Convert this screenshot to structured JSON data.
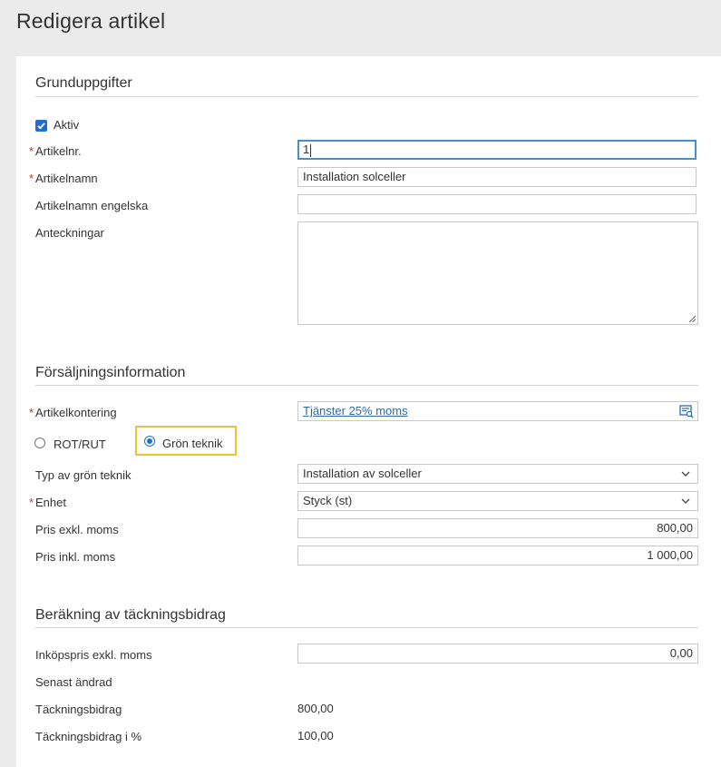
{
  "page": {
    "title": "Redigera artikel"
  },
  "sections": {
    "basic": {
      "title": "Grunduppgifter"
    },
    "sales": {
      "title": "Försäljningsinformation"
    },
    "margin": {
      "title": "Beräkning av täckningsbidrag"
    }
  },
  "basic": {
    "active_label": "Aktiv",
    "active_checked": true,
    "article_no_label": "Artikelnr.",
    "article_no_value": "1",
    "article_name_label": "Artikelnamn",
    "article_name_value": "Installation solceller",
    "article_name_en_label": "Artikelnamn engelska",
    "article_name_en_value": "",
    "notes_label": "Anteckningar",
    "notes_value": ""
  },
  "sales": {
    "account_label": "Artikelkontering",
    "account_value": "Tjänster 25% moms",
    "rot_rut_label": "ROT/RUT",
    "green_tech_label": "Grön teknik",
    "green_tech_selected": true,
    "green_type_label": "Typ av grön teknik",
    "green_type_value": "Installation av solceller",
    "unit_label": "Enhet",
    "unit_value": "Styck (st)",
    "price_excl_label": "Pris exkl. moms",
    "price_excl_value": "800,00",
    "price_incl_label": "Pris inkl. moms",
    "price_incl_value": "1 000,00"
  },
  "margin": {
    "purchase_label": "Inköpspris exkl. moms",
    "purchase_value": "0,00",
    "last_changed_label": "Senast ändrad",
    "contribution_label": "Täckningsbidrag",
    "contribution_value": "800,00",
    "contribution_pct_label": "Täckningsbidrag i %",
    "contribution_pct_value": "100,00"
  },
  "colors": {
    "accent": "#1f6fd0",
    "required": "#c0392b",
    "highlight": "#f2c22e",
    "link": "#2c6aa8"
  }
}
